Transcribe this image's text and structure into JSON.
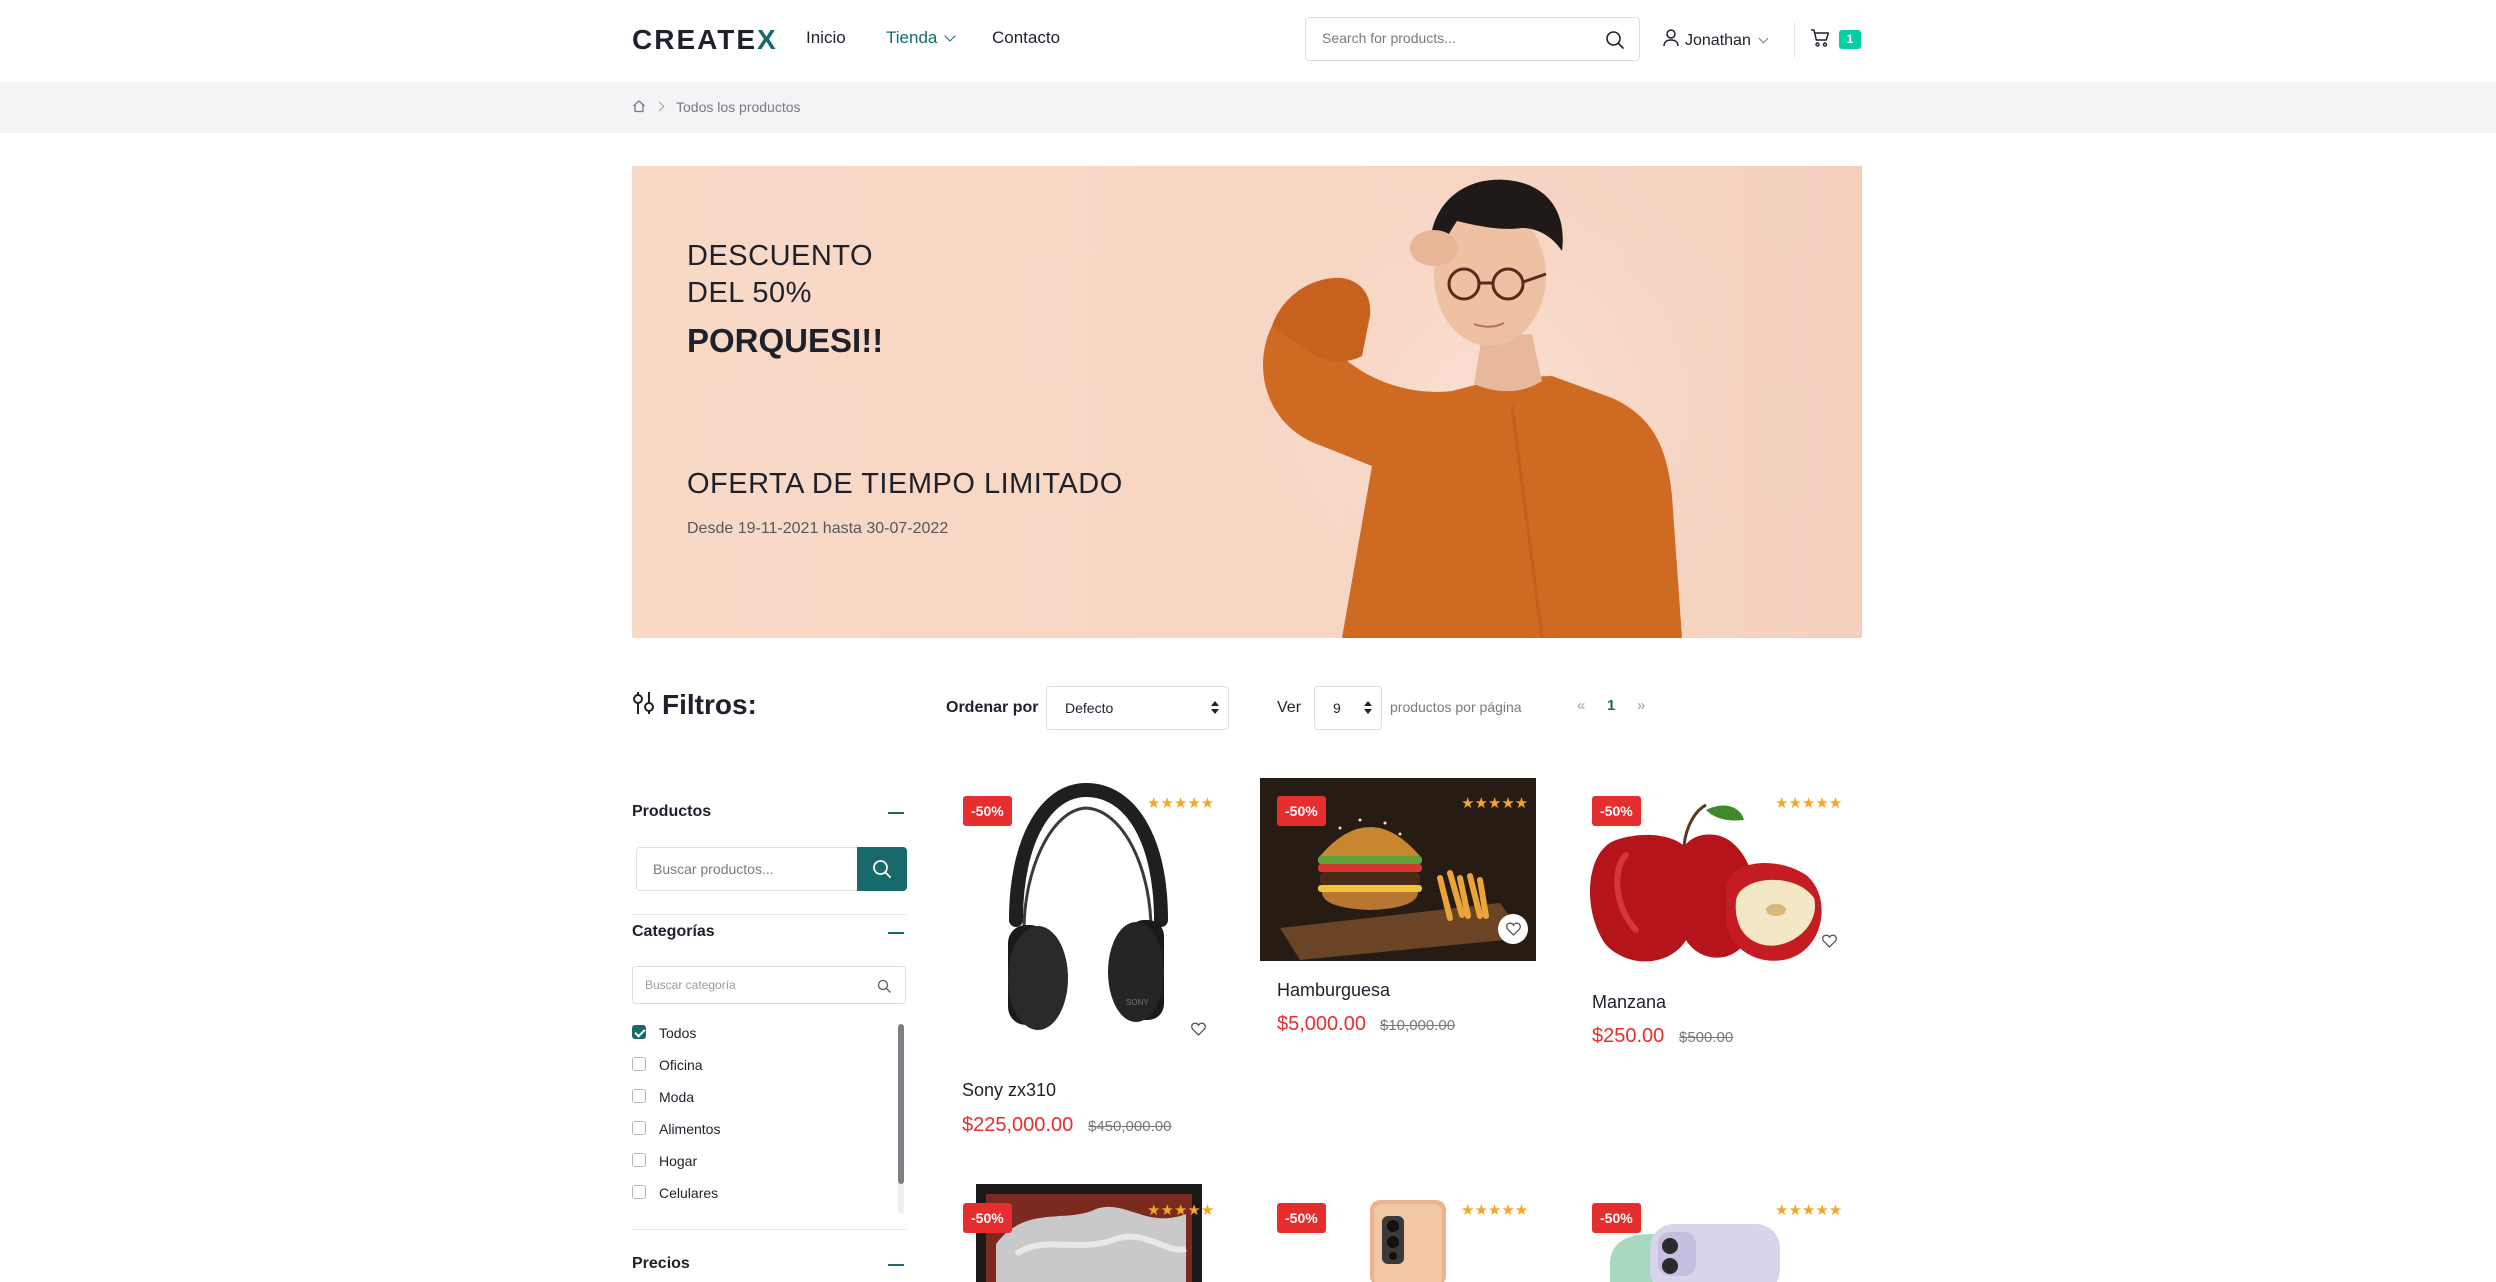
{
  "header": {
    "logo_main": "CREATE",
    "logo_accent": "X",
    "nav": [
      {
        "label": "Inicio"
      },
      {
        "label": "Tienda"
      },
      {
        "label": "Contacto"
      }
    ],
    "search_placeholder": "Search for products...",
    "user_name": "Jonathan",
    "cart_count": "1"
  },
  "breadcrumb": {
    "items": [
      "Todos los productos"
    ]
  },
  "hero": {
    "line1": "DESCUENTO",
    "line2": "DEL 50%",
    "line3": "PORQUESI!!",
    "offer_title": "OFERTA DE TIEMPO LIMITADO",
    "offer_dates": "Desde 19-11-2021 hasta 30-07-2022"
  },
  "toolbar": {
    "filters_title": "Filtros:",
    "order_label": "Ordenar por",
    "order_value": "Defecto",
    "view_label": "Ver",
    "per_page_value": "9",
    "per_page_label": "productos por página",
    "pager_prev": "«",
    "pager_current": "1",
    "pager_next": "»"
  },
  "sidebar": {
    "products_title": "Productos",
    "products_search_placeholder": "Buscar productos...",
    "categories_title": "Categorías",
    "categories_search_placeholder": "Buscar categoría",
    "categories": [
      {
        "label": "Todos",
        "checked": true
      },
      {
        "label": "Oficina",
        "checked": false
      },
      {
        "label": "Moda",
        "checked": false
      },
      {
        "label": "Alimentos",
        "checked": false
      },
      {
        "label": "Hogar",
        "checked": false
      },
      {
        "label": "Celulares",
        "checked": false
      }
    ],
    "prices_title": "Precios"
  },
  "products": [
    {
      "name": "Sony zx310",
      "price": "$225,000.00",
      "old_price": "$450,000.00",
      "discount": "-50%",
      "rating": 5
    },
    {
      "name": "Hamburguesa",
      "price": "$5,000.00",
      "old_price": "$10,000.00",
      "discount": "-50%",
      "rating": 5
    },
    {
      "name": "Manzana",
      "price": "$250.00",
      "old_price": "$500.00",
      "discount": "-50%",
      "rating": 5
    },
    {
      "name": "",
      "price": "",
      "old_price": "",
      "discount": "-50%",
      "rating": 5
    },
    {
      "name": "",
      "price": "",
      "old_price": "",
      "discount": "-50%",
      "rating": 5
    },
    {
      "name": "",
      "price": "",
      "old_price": "",
      "discount": "-50%",
      "rating": 5
    }
  ],
  "colors": {
    "accent": "#17696a",
    "sale": "#e72e2e",
    "badge_cart": "#03cea4",
    "stars": "#f5a623"
  }
}
